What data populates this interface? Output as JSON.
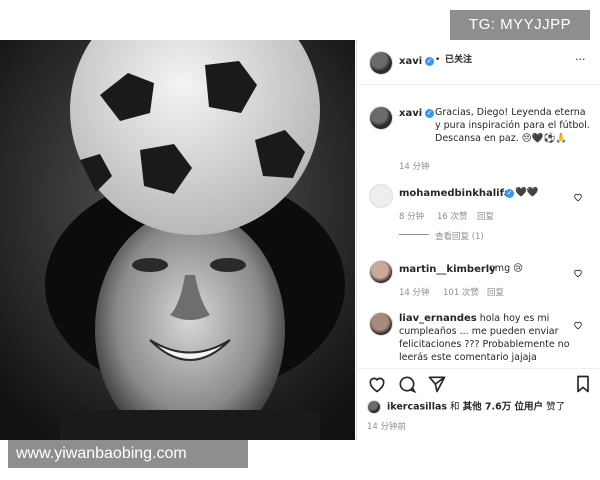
{
  "watermarks": {
    "top": "TG: MYYJJPP",
    "bottom": "www.yiwanbaobing.com"
  },
  "header": {
    "username": "xavi",
    "dot": "•",
    "follow_status": "已关注",
    "more": "···"
  },
  "caption": {
    "username": "xavi",
    "text": "Gracias, Diego! Leyenda eterna y pura inspiración para el fútbol. Descansa en paz. 😔🖤⚽🙏",
    "time": "14 分钟"
  },
  "comments": [
    {
      "username": "mohamedbinkhalifa",
      "text": "🖤🖤",
      "time": "8 分钟",
      "likes": "16 次赞",
      "reply": "回复",
      "view_replies": "查看回复 (1)"
    },
    {
      "username": "martin__kimberly",
      "text": "omg 😢",
      "time": "14 分钟",
      "likes": "101 次赞",
      "reply": "回复"
    },
    {
      "username": "liav_ernandes",
      "text": "hola hoy es mi cumpleaños ... me pueden enviar felicitaciones ??? Probablemente no leerás este comentario jajaja",
      "time": "",
      "likes": "",
      "reply": ""
    }
  ],
  "likes": {
    "prefix_user": "ikercasillas",
    "connector": "和",
    "others": "其他 7.6万 位用户",
    "suffix": "赞了"
  },
  "post_time": "14 分钟前",
  "icons": [
    "heart-icon",
    "comment-icon",
    "share-icon",
    "bookmark-icon",
    "more-icon",
    "verified-icon"
  ]
}
